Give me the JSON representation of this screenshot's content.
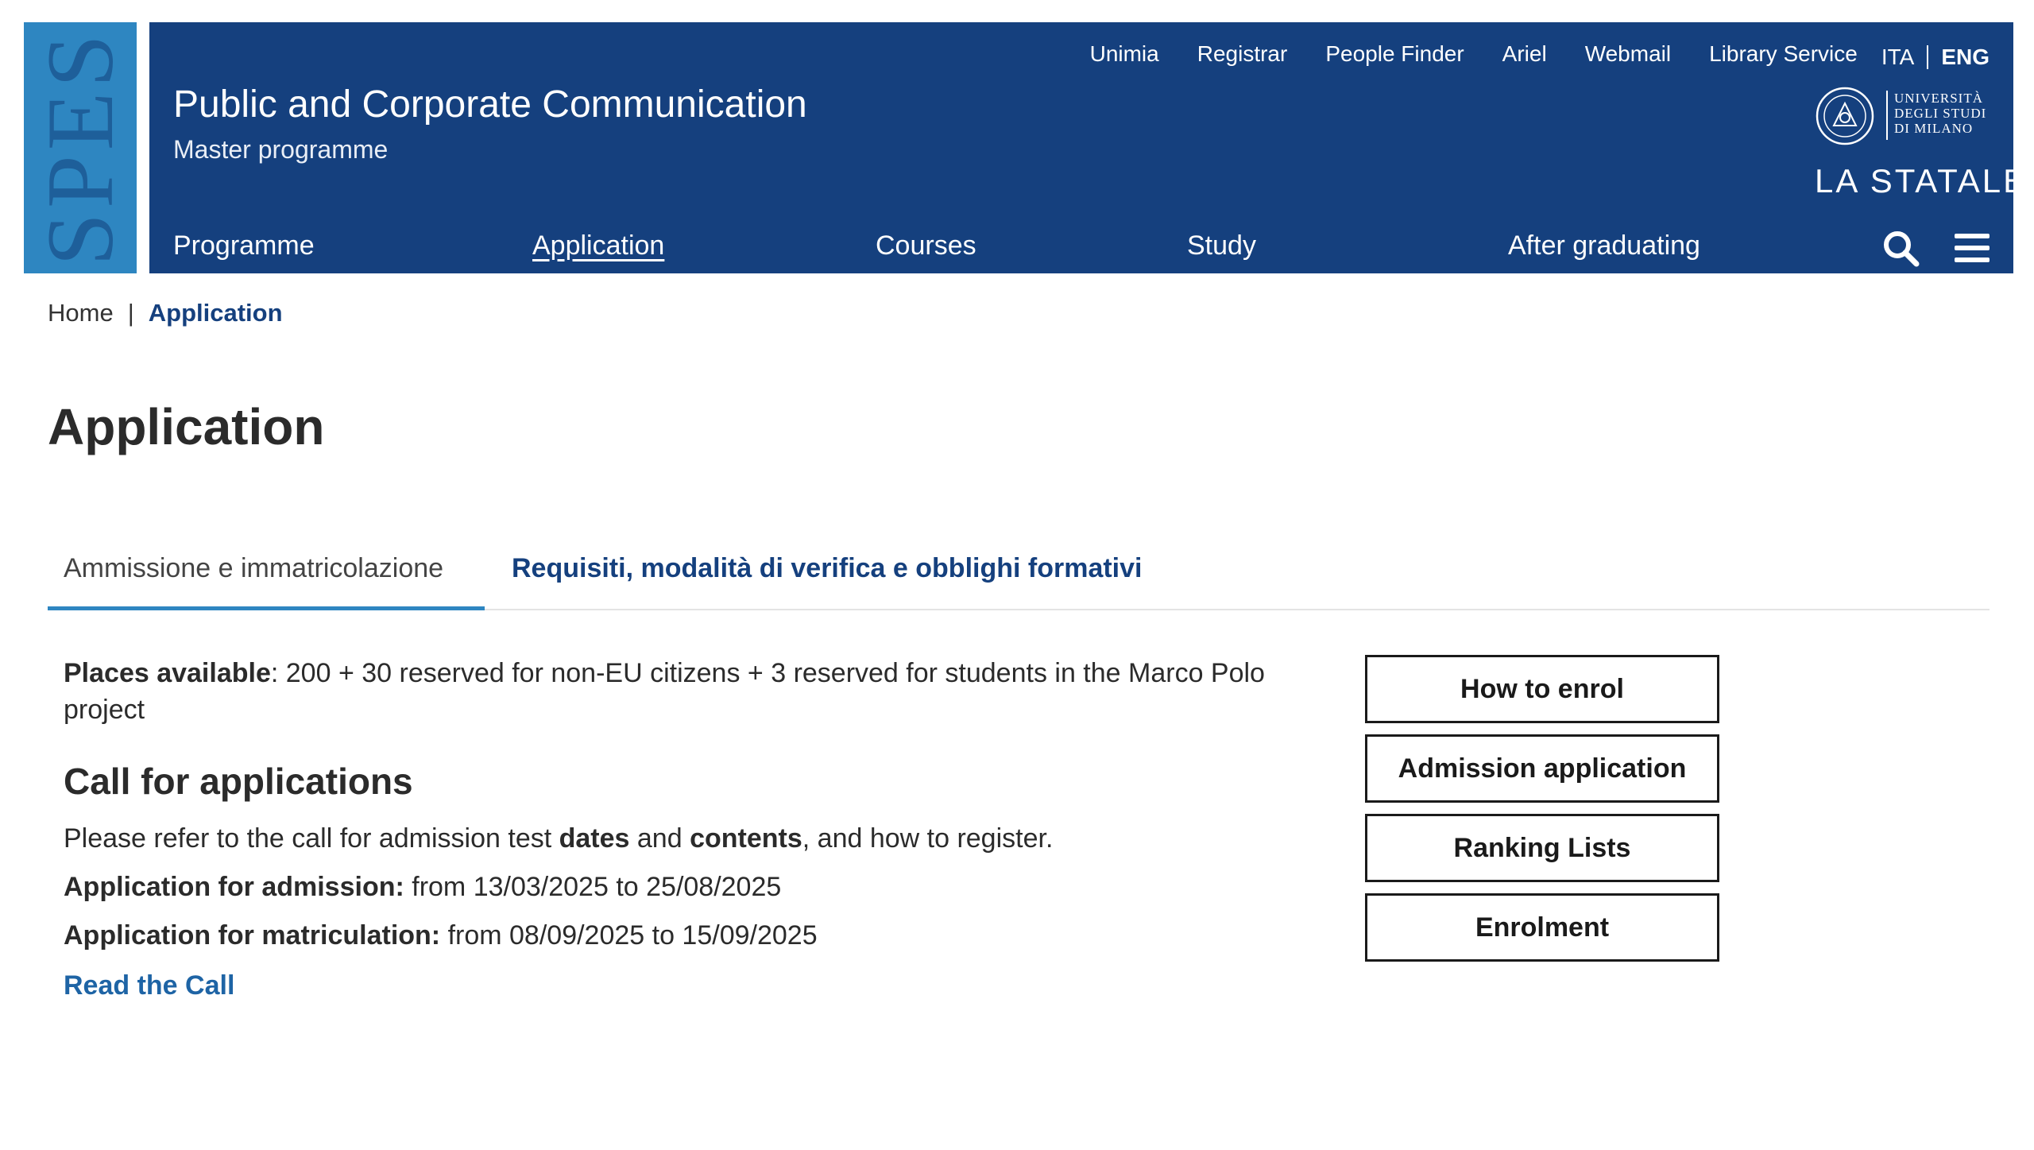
{
  "brand": {
    "spes_text": "SPES"
  },
  "site": {
    "title": "Public and Corporate Communication",
    "subtitle": "Master programme"
  },
  "top_links": [
    "Unimia",
    "Registrar",
    "People Finder",
    "Ariel",
    "Webmail",
    "Library Service"
  ],
  "language": {
    "ita": "ITA",
    "eng": "ENG",
    "active": "ENG"
  },
  "university_logo": {
    "name_lines": [
      "UNIVERSITÀ",
      "DEGLI STUDI",
      "DI MILANO"
    ],
    "wordmark": "LA STATALE"
  },
  "main_nav": [
    {
      "label": "Programme",
      "active": false
    },
    {
      "label": "Application",
      "active": true
    },
    {
      "label": "Courses",
      "active": false
    },
    {
      "label": "Study",
      "active": false
    },
    {
      "label": "After graduating",
      "active": false
    }
  ],
  "nav_icons": [
    "search-icon",
    "menu-icon"
  ],
  "breadcrumb": {
    "home": "Home",
    "separator": "|",
    "current": "Application"
  },
  "page": {
    "title": "Application"
  },
  "tabs": [
    {
      "label": "Ammissione e immatricolazione",
      "active": true
    },
    {
      "label": "Requisiti, modalità di verifica e obblighi formativi",
      "active": false
    }
  ],
  "content": {
    "places_label": "Places available",
    "places_text": ": 200 + 30 reserved for non-EU citizens + 3 reserved for students in the Marco Polo project",
    "call_heading": "Call for applications",
    "call_text_1": "Please refer to the call for admission test ",
    "call_bold_1": "dates",
    "call_text_2": " and ",
    "call_bold_2": "contents",
    "call_text_3": ", and how to register.",
    "admission_label": "Application for admission:",
    "admission_value": " from 13/03/2025 to 25/08/2025",
    "matriculation_label": "Application for matriculation:",
    "matriculation_value": " from 08/09/2025 to 15/09/2025",
    "read_call": "Read the Call"
  },
  "side_buttons": [
    "How to enrol",
    "Admission application",
    "Ranking Lists",
    "Enrolment"
  ],
  "colors": {
    "banner": "#15407e",
    "spes": "#2e86c1",
    "tab_accent": "#2e86c1",
    "link": "#1e64a5"
  }
}
